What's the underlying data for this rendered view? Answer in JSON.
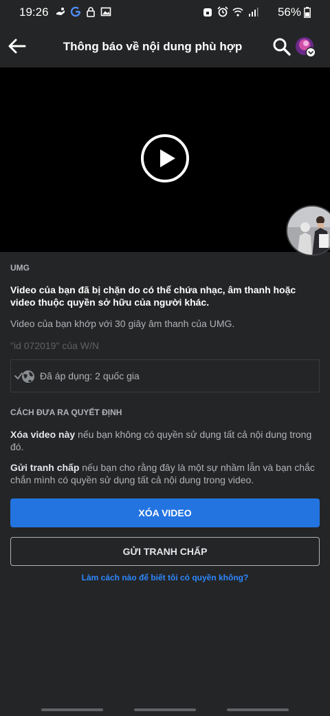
{
  "status_bar": {
    "time": "19:26",
    "battery": "56%",
    "left_icons": [
      "hand-icon",
      "google-icon",
      "lock-icon",
      "image-icon"
    ],
    "right_icons": [
      "alarm-lock-icon",
      "alarm-icon",
      "wifi-icon",
      "signal-icon",
      "battery-icon"
    ]
  },
  "app_bar": {
    "title": "Thông báo về nội dung phù hợp"
  },
  "notice": {
    "source": "UMG",
    "blocked_message": "Video của bạn  đã bị chặn do có thể chứa nhạc, âm thanh hoặc video thuộc quyền sở hữu của người khác.",
    "match_message": "Video của bạn khớp với 30 giây âm thanh của UMG.",
    "track_info": "\"id 072019\" của W/N",
    "applied_text": "Đã áp dụng: 2 quốc gia"
  },
  "decision": {
    "heading": "CÁCH ĐƯA RA QUYẾT ĐỊNH",
    "delete_bold": "Xóa video này",
    "delete_text": " nếu bạn không có quyền sử dụng tất cả nội dung trong đó.",
    "dispute_bold": "Gửi tranh chấp",
    "dispute_text": " nếu bạn cho rằng đây là một sự nhầm lẫn và bạn chắc chắn mình có quyền sử dụng tất cả nội dung trong video."
  },
  "actions": {
    "delete_label": "XÓA VIDEO",
    "dispute_label": "GỬI TRANH CHẤP",
    "help_link": "Làm cách nào để biết tôi có quyền không?"
  },
  "colors": {
    "background": "#242526",
    "primary": "#2374e1",
    "link": "#2d88ff"
  }
}
